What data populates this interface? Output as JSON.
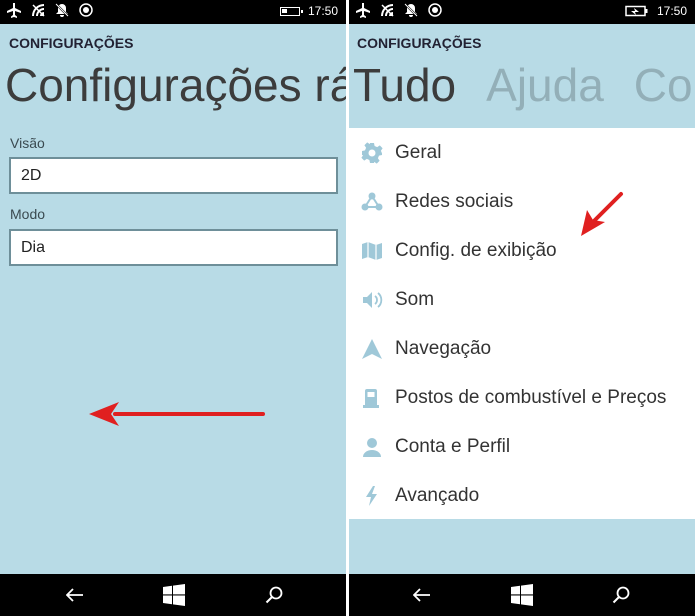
{
  "status_bar": {
    "time": "17:50"
  },
  "left_screen": {
    "app_title": "CONFIGURAÇÕES",
    "pivot_header": "Configurações rá",
    "fields": [
      {
        "label": "Visão",
        "value": "2D"
      },
      {
        "label": "Modo",
        "value": "Dia"
      }
    ]
  },
  "right_screen": {
    "app_title": "CONFIGURAÇÕES",
    "pivot_tabs": [
      {
        "label": "Tudo",
        "active": true
      },
      {
        "label": "Ajuda",
        "active": false
      },
      {
        "label": "Co",
        "active": false
      }
    ],
    "settings_items": [
      {
        "label": "Geral",
        "icon": "gear-icon"
      },
      {
        "label": "Redes sociais",
        "icon": "share-icon"
      },
      {
        "label": "Config. de exibição",
        "icon": "map-icon"
      },
      {
        "label": "Som",
        "icon": "speaker-icon"
      },
      {
        "label": "Navegação",
        "icon": "navigation-arrow-icon"
      },
      {
        "label": "Postos de combustível e Preços",
        "icon": "fuel-pump-icon"
      },
      {
        "label": "Conta e Perfil",
        "icon": "person-icon"
      },
      {
        "label": "Avançado",
        "icon": "lightning-icon"
      }
    ]
  },
  "nav_bar": {
    "icons": [
      "back-arrow-icon",
      "windows-start-icon",
      "search-icon"
    ]
  },
  "colors": {
    "background": "#b8dbe6",
    "list_icon": "#9fc8d8",
    "annotation_arrow": "#e02020"
  }
}
